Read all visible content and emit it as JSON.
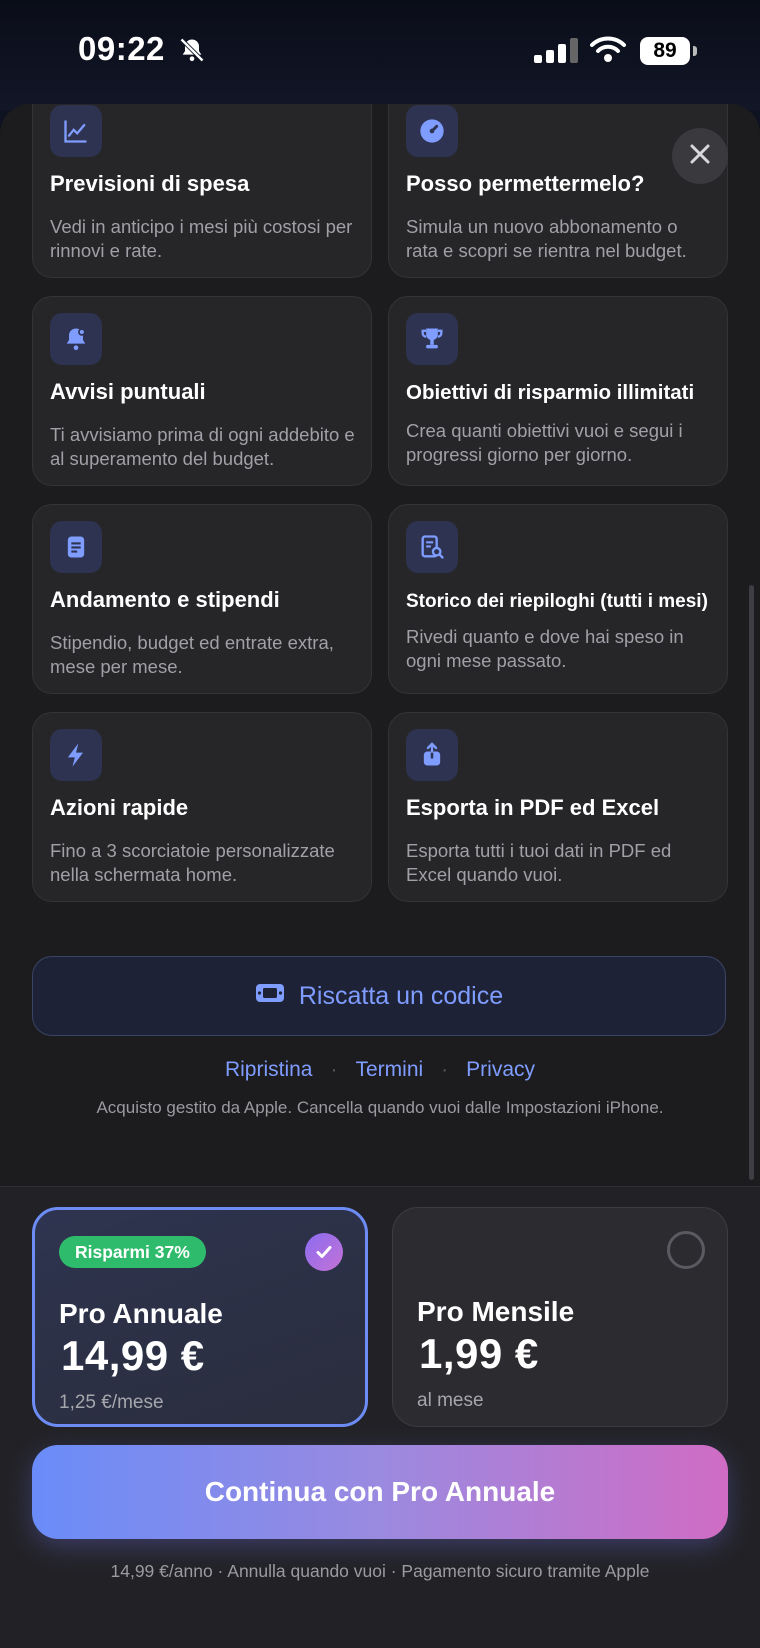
{
  "status_bar": {
    "time": "09:22",
    "battery": "89"
  },
  "features": [
    {
      "title": "Previsioni di spesa",
      "description": "Vedi in anticipo i mesi più costosi per rinnovi e rate.",
      "icon": "chart-line-icon"
    },
    {
      "title": "Posso permettermelo?",
      "description": "Simula un nuovo abbonamento o rata e scopri se rientra nel budget.",
      "icon": "gauge-icon"
    },
    {
      "title": "Avvisi puntuali",
      "description": "Ti avvisiamo prima di ogni addebito e al superamento del budget.",
      "icon": "bell-icon"
    },
    {
      "title": "Obiettivi di risparmio illimitati",
      "description": "Crea quanti obiettivi vuoi e segui i progressi giorno per giorno.",
      "icon": "trophy-icon"
    },
    {
      "title": "Andamento e stipendi",
      "description": "Stipendio, budget ed entrate extra, mese per mese.",
      "icon": "document-icon"
    },
    {
      "title": "Storico dei riepiloghi (tutti i mesi)",
      "description": "Rivedi quanto e dove hai speso in ogni mese passato.",
      "icon": "report-search-icon"
    },
    {
      "title": "Azioni rapide",
      "description": "Fino a 3 scorciatoie personalizzate nella schermata home.",
      "icon": "bolt-icon"
    },
    {
      "title": "Esporta in PDF ed Excel",
      "description": "Esporta tutti i tuoi dati in PDF ed Excel quando vuoi.",
      "icon": "share-icon"
    }
  ],
  "redeem": {
    "label": "Riscatta un codice"
  },
  "links": {
    "restore": "Ripristina",
    "terms": "Termini",
    "privacy": "Privacy"
  },
  "legal": "Acquisto gestito da Apple. Cancella quando vuoi dalle Impostazioni iPhone.",
  "plans": {
    "annual": {
      "badge": "Risparmi 37%",
      "name": "Pro Annuale",
      "price": "14,99 €",
      "sub": "1,25 €/mese",
      "selected": true
    },
    "monthly": {
      "name": "Pro Mensile",
      "price": "1,99 €",
      "sub": "al mese",
      "selected": false
    }
  },
  "cta": {
    "label": "Continua con Pro Annuale"
  },
  "footnote": "14,99 €/anno · Annulla quando vuoi · Pagamento sicuro tramite Apple",
  "colors": {
    "accent": "#7f9cff",
    "badge": "#2ebc6c",
    "cta_start": "#6a8cf8",
    "cta_end": "#d06cc4"
  }
}
